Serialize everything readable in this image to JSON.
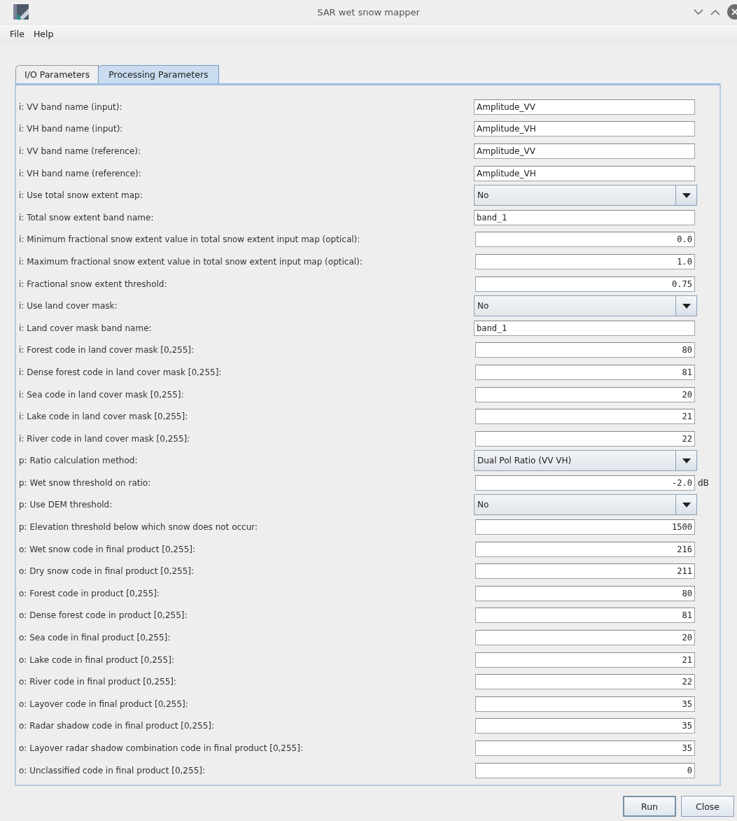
{
  "window": {
    "title": "SAR wet snow mapper"
  },
  "menu": [
    "File",
    "Help"
  ],
  "tabs": [
    {
      "label": "I/O Parameters",
      "selected": false
    },
    {
      "label": "Processing Parameters",
      "selected": true
    }
  ],
  "parameters": [
    {
      "label": "i: VV band name (input):",
      "kind": "text",
      "value": "Amplitude_VV"
    },
    {
      "label": "i: VH band name (input):",
      "kind": "text",
      "value": "Amplitude_VH"
    },
    {
      "label": "i: VV band name (reference):",
      "kind": "text",
      "value": "Amplitude_VV"
    },
    {
      "label": "i: VH band name (reference):",
      "kind": "text",
      "value": "Amplitude_VH"
    },
    {
      "label": "i: Use total snow extent map:",
      "kind": "combo",
      "value": "No"
    },
    {
      "label": "i: Total snow extent band name:",
      "kind": "code",
      "value": "band_1"
    },
    {
      "label": "i: Minimum fractional snow extent value in total snow extent input map (optical):",
      "kind": "number",
      "value": "0.0"
    },
    {
      "label": "i: Maximum fractional snow extent value in total snow extent input map (optical):",
      "kind": "number",
      "value": "1.0"
    },
    {
      "label": "i: Fractional snow extent threshold:",
      "kind": "number",
      "value": "0.75"
    },
    {
      "label": "i: Use land cover mask:",
      "kind": "combo",
      "value": "No"
    },
    {
      "label": "i: Land cover mask band name:",
      "kind": "code",
      "value": "band_1"
    },
    {
      "label": "i: Forest code in land cover mask [0,255]:",
      "kind": "number",
      "value": "80"
    },
    {
      "label": "i: Dense forest code in land cover mask [0,255]:",
      "kind": "number",
      "value": "81"
    },
    {
      "label": "i: Sea code in land cover mask [0,255]:",
      "kind": "number",
      "value": "20"
    },
    {
      "label": "i: Lake code in land cover mask [0,255]:",
      "kind": "number",
      "value": "21"
    },
    {
      "label": "i: River code in land cover mask [0,255]:",
      "kind": "number",
      "value": "22"
    },
    {
      "label": "p: Ratio calculation method:",
      "kind": "combo",
      "value": "Dual Pol Ratio (VV VH)"
    },
    {
      "label": "p: Wet snow threshold on ratio:",
      "kind": "number",
      "value": "-2.0",
      "unit": "dB"
    },
    {
      "label": "p: Use DEM threshold:",
      "kind": "combo",
      "value": "No"
    },
    {
      "label": "p: Elevation threshold below which snow does not occur:",
      "kind": "number",
      "value": "1500"
    },
    {
      "label": "o: Wet snow code in final product [0,255]:",
      "kind": "number",
      "value": "216"
    },
    {
      "label": "o: Dry snow code in final product [0,255]:",
      "kind": "number",
      "value": "211"
    },
    {
      "label": "o: Forest code in product [0,255]:",
      "kind": "number",
      "value": "80"
    },
    {
      "label": "o: Dense forest code in product [0,255]:",
      "kind": "number",
      "value": "81"
    },
    {
      "label": "o: Sea code in final product [0,255]:",
      "kind": "number",
      "value": "20"
    },
    {
      "label": "o: Lake code in final product [0,255]:",
      "kind": "number",
      "value": "21"
    },
    {
      "label": "o: River code in final product [0,255]:",
      "kind": "number",
      "value": "22"
    },
    {
      "label": "o: Layover code in final product [0,255]:",
      "kind": "number",
      "value": "35"
    },
    {
      "label": "o: Radar shadow code in final product [0,255]:",
      "kind": "number",
      "value": "35"
    },
    {
      "label": "o: Layover radar shadow combination code in final product [0,255]:",
      "kind": "number",
      "value": "35"
    },
    {
      "label": "o: Unclassified code in final product [0,255]:",
      "kind": "number",
      "value": "0"
    }
  ],
  "buttons": [
    {
      "label": "Run",
      "default": true
    },
    {
      "label": "Close",
      "default": false
    }
  ]
}
